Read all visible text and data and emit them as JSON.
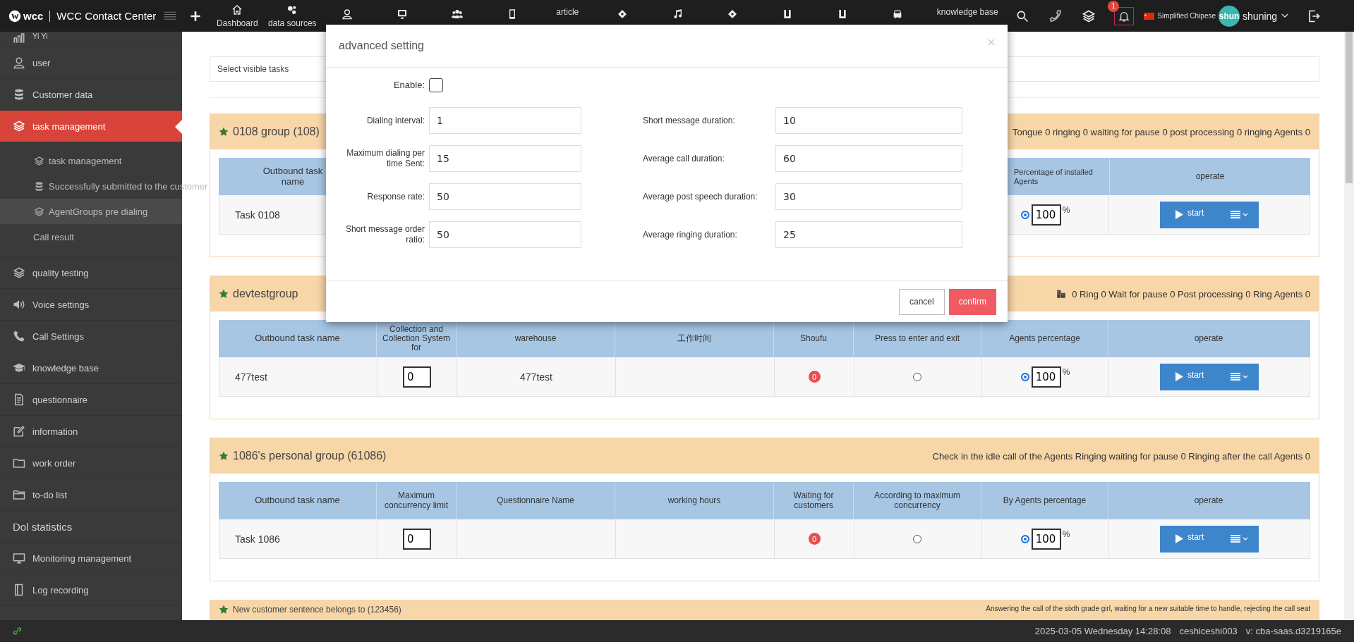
{
  "topbar": {
    "logo": "wcc",
    "title": "WCC Contact Center",
    "nav": [
      {
        "kind": "icon-label",
        "label": "Dashboard"
      },
      {
        "kind": "icon-label",
        "label": "data sources"
      },
      {
        "kind": "icon"
      },
      {
        "kind": "icon"
      },
      {
        "kind": "icon"
      },
      {
        "kind": "icon"
      },
      {
        "kind": "text",
        "label": "article"
      },
      {
        "kind": "icon"
      },
      {
        "kind": "icon"
      },
      {
        "kind": "icon"
      },
      {
        "kind": "icon"
      },
      {
        "kind": "icon"
      },
      {
        "kind": "icon"
      },
      {
        "kind": "text",
        "label": "knowledge base"
      }
    ],
    "notifications": "1",
    "language": "Simplified Chipese",
    "user": {
      "avatar": "shun",
      "name": "shuning"
    }
  },
  "sidebar": {
    "items": [
      {
        "kind": "icon",
        "label": "Yi Yi",
        "selected": false
      },
      {
        "kind": "icon",
        "label": "user",
        "selected": false
      },
      {
        "kind": "icon",
        "label": "Customer data",
        "selected": false
      },
      {
        "kind": "icon",
        "label": "task management",
        "selected": true,
        "children": [
          {
            "kind": "icon",
            "label": "task management",
            "selected": false
          },
          {
            "kind": "icon",
            "label": "Successfully submitted to the customer",
            "selected": false
          },
          {
            "kind": "icon",
            "label": "AgentGroups pre dialing",
            "selected": true
          },
          {
            "kind": "plain",
            "label": "Call result",
            "selected": false
          }
        ]
      },
      {
        "kind": "icon",
        "label": "quality testing",
        "selected": false
      },
      {
        "kind": "icon",
        "label": "Voice settings",
        "selected": false
      },
      {
        "kind": "icon",
        "label": "Call Settings",
        "selected": false
      },
      {
        "kind": "icon",
        "label": "knowledge base",
        "selected": false
      },
      {
        "kind": "icon",
        "label": "questionnaire",
        "selected": false
      },
      {
        "kind": "icon",
        "label": "information",
        "selected": false
      },
      {
        "kind": "icon",
        "label": "work order",
        "selected": false
      },
      {
        "kind": "icon",
        "label": "to-do list",
        "selected": false
      },
      {
        "kind": "plain",
        "label": "Dol statistics",
        "selected": false
      },
      {
        "kind": "icon",
        "label": "Monitoring management",
        "selected": false
      },
      {
        "kind": "icon",
        "label": "Log recording",
        "selected": false
      }
    ]
  },
  "task_filter": {
    "placeholder": "Select visible tasks"
  },
  "groups": [
    {
      "title": "0108 group (108)",
      "status": "Tongue 0 ringing 0 waiting for pause 0 post processing 0 ringing Agents 0",
      "table": {
        "columns": [
          "Outbound task name",
          "Percentage of installed Agents",
          "operate"
        ],
        "rows": [
          {
            "cells": [
              {
                "kind": "text",
                "text": "Task 0108"
              },
              {
                "kind": "percent",
                "selected": true,
                "value": "100",
                "unit": "%"
              },
              {
                "kind": "action",
                "label": "start"
              }
            ]
          }
        ]
      }
    },
    {
      "title": "devtestgroup",
      "status": "0 Ring 0 Wait for pause 0 Post processing 0 Ring Agents 0",
      "table": {
        "columns": [
          "Outbound task name",
          "Collection and Collection System for",
          "warehouse",
          "工作时间",
          "Shoufu",
          "Press to enter and exit",
          "Agents percentage",
          "operate"
        ],
        "rows": [
          {
            "cells": [
              {
                "kind": "text",
                "text": "477test"
              },
              {
                "kind": "input",
                "value": "0"
              },
              {
                "kind": "text",
                "text": "477test"
              },
              {
                "kind": "empty"
              },
              {
                "kind": "badge",
                "text": "0"
              },
              {
                "kind": "radio",
                "selected": false
              },
              {
                "kind": "percent",
                "selected": true,
                "value": "100",
                "unit": "%"
              },
              {
                "kind": "action",
                "label": "start"
              }
            ]
          }
        ]
      }
    },
    {
      "title": "1086's personal group (61086)",
      "status": "Check in the idle call of the Agents Ringing waiting for pause 0 Ringing after the call Agents 0",
      "table": {
        "columns": [
          "Outbound task name",
          "Maximum concurrency limit",
          "Questionnaire Name",
          "working hours",
          "Waiting for customers",
          "According to maximum concurrency",
          "By Agents percentage",
          "operate"
        ],
        "rows": [
          {
            "cells": [
              {
                "kind": "text",
                "text": "Task 1086"
              },
              {
                "kind": "input",
                "value": "0"
              },
              {
                "kind": "empty"
              },
              {
                "kind": "empty"
              },
              {
                "kind": "badge",
                "text": "0"
              },
              {
                "kind": "radio",
                "selected": false
              },
              {
                "kind": "percent",
                "selected": true,
                "value": "100",
                "unit": "%"
              },
              {
                "kind": "action",
                "label": "start"
              }
            ]
          }
        ]
      }
    },
    {
      "title": "New customer sentence belongs to (123456)",
      "status": "Answering the call of the sixth grade girl, waiting for a new suitable time to handle, rejecting the call seat"
    }
  ],
  "dialog": {
    "title": "advanced setting",
    "enable": {
      "label": "Enable:",
      "checked": false
    },
    "left_fields": [
      {
        "label": "Dialing interval:",
        "value": "1"
      },
      {
        "label": "Maximum dialing per time Sent:",
        "value": "15"
      },
      {
        "label": "Response rate:",
        "value": "50"
      },
      {
        "label": "Short message order ratio:",
        "value": "50"
      }
    ],
    "right_fields": [
      {
        "label": "Short message duration:",
        "value": "10"
      },
      {
        "label": "Average call duration:",
        "value": "60"
      },
      {
        "label": "Average post speech duration:",
        "value": "30"
      },
      {
        "label": "Average ringing duration:",
        "value": "25"
      }
    ],
    "buttons": [
      {
        "kind": "secondary",
        "label": "cancel"
      },
      {
        "kind": "primary",
        "label": "confirm"
      }
    ]
  },
  "status_bar": {
    "time": "2025-03-05 Wednesday 14:28:08",
    "account": "ceshiceshi003",
    "version": "v: cba-saas.d3219165e"
  }
}
